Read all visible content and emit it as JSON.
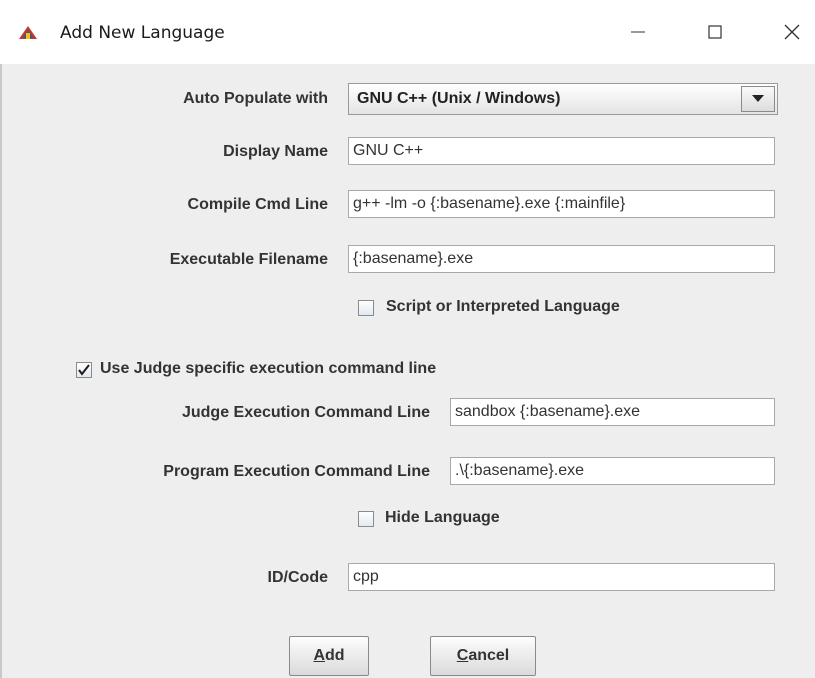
{
  "window": {
    "title": "Add New Language",
    "icon": "app-icon",
    "controls": {
      "minimize": "minimize-icon",
      "maximize": "maximize-icon",
      "close": "close-icon"
    }
  },
  "form": {
    "auto_populate_label": "Auto Populate with",
    "auto_populate_value": "GNU C++ (Unix / Windows)",
    "display_name_label": "Display Name",
    "display_name_value": "GNU C++",
    "compile_cmd_label": "Compile Cmd Line",
    "compile_cmd_value": "g++ -lm -o {:basename}.exe {:mainfile}",
    "exec_filename_label": "Executable Filename",
    "exec_filename_value": "{:basename}.exe",
    "script_label": "Script or Interpreted Language",
    "script_checked": false,
    "use_judge_label": "Use Judge specific execution command line",
    "use_judge_checked": true,
    "judge_exec_label": "Judge Execution Command Line",
    "judge_exec_value": "sandbox {:basename}.exe",
    "program_exec_label": "Program Execution Command Line",
    "program_exec_value": ".\\{:basename}.exe",
    "hide_language_label": "Hide Language",
    "hide_language_checked": false,
    "id_code_label": "ID/Code",
    "id_code_value": "cpp"
  },
  "buttons": {
    "add_prefix": "A",
    "add_rest": "dd",
    "cancel_prefix": "C",
    "cancel_rest": "ancel"
  }
}
